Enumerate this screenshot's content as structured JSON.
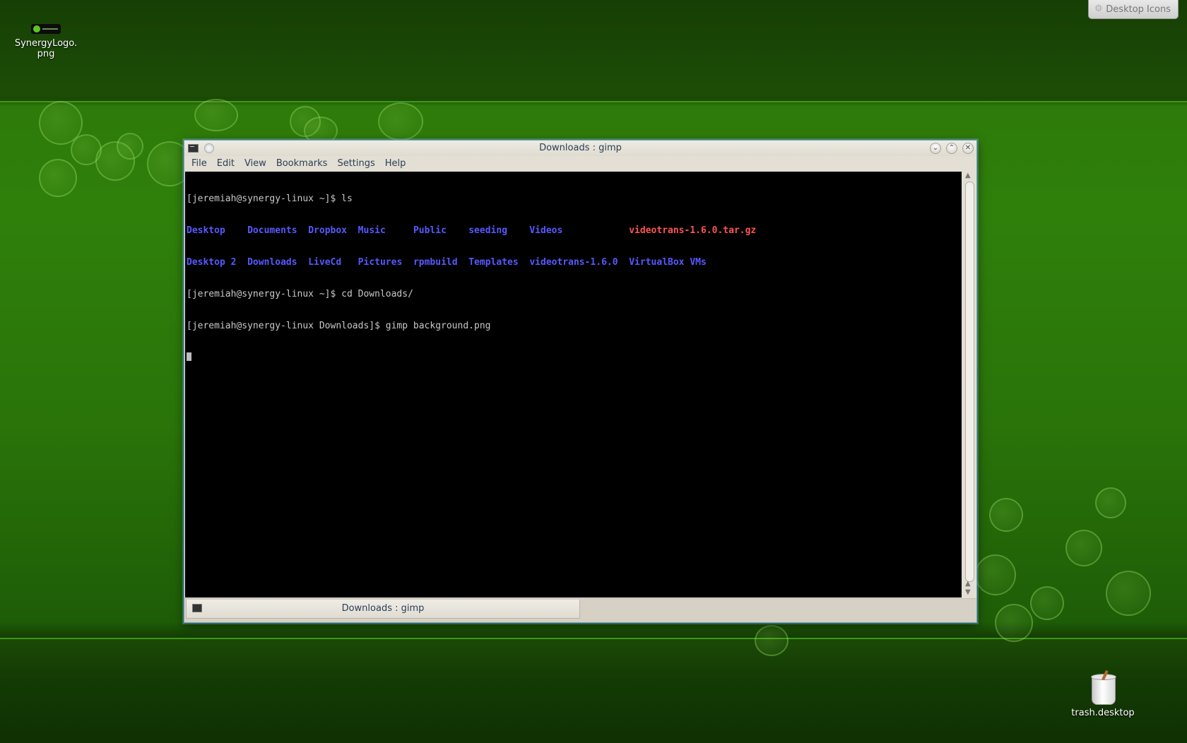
{
  "desktop": {
    "icons": [
      {
        "label": "SynergyLogo.\npng"
      },
      {
        "label": "trash.desktop"
      }
    ],
    "desktop_icons_button": "Desktop Icons"
  },
  "window": {
    "title": "Downloads : gimp",
    "menu": [
      "File",
      "Edit",
      "View",
      "Bookmarks",
      "Settings",
      "Help"
    ],
    "terminal": {
      "prompt1": "[jeremiah@synergy-linux ~]$ ls",
      "ls_row1": [
        {
          "name": "Desktop",
          "type": "dir"
        },
        {
          "name": "Documents",
          "type": "dir"
        },
        {
          "name": "Dropbox",
          "type": "dir"
        },
        {
          "name": "Music",
          "type": "dir"
        },
        {
          "name": "Public",
          "type": "dir"
        },
        {
          "name": "seeding",
          "type": "dir"
        },
        {
          "name": "Videos",
          "type": "dir"
        },
        {
          "name": "videotrans-1.6.0.tar.gz",
          "type": "archive"
        }
      ],
      "ls_row2": [
        {
          "name": "Desktop 2",
          "type": "dir"
        },
        {
          "name": "Downloads",
          "type": "dir"
        },
        {
          "name": "LiveCd",
          "type": "dir"
        },
        {
          "name": "Pictures",
          "type": "dir"
        },
        {
          "name": "rpmbuild",
          "type": "dir"
        },
        {
          "name": "Templates",
          "type": "dir"
        },
        {
          "name": "videotrans-1.6.0",
          "type": "dir"
        },
        {
          "name": "VirtualBox VMs",
          "type": "dir"
        }
      ],
      "prompt2": "[jeremiah@synergy-linux ~]$ cd Downloads/",
      "prompt3": "[jeremiah@synergy-linux Downloads]$ gimp background.png"
    },
    "tab_label": "Downloads : gimp"
  },
  "colors": {
    "dir": "#5858ff",
    "archive": "#ff5454",
    "terminal_bg": "#000000",
    "terminal_fg": "#c8c8c8",
    "desktop_green": "#2f800b"
  }
}
